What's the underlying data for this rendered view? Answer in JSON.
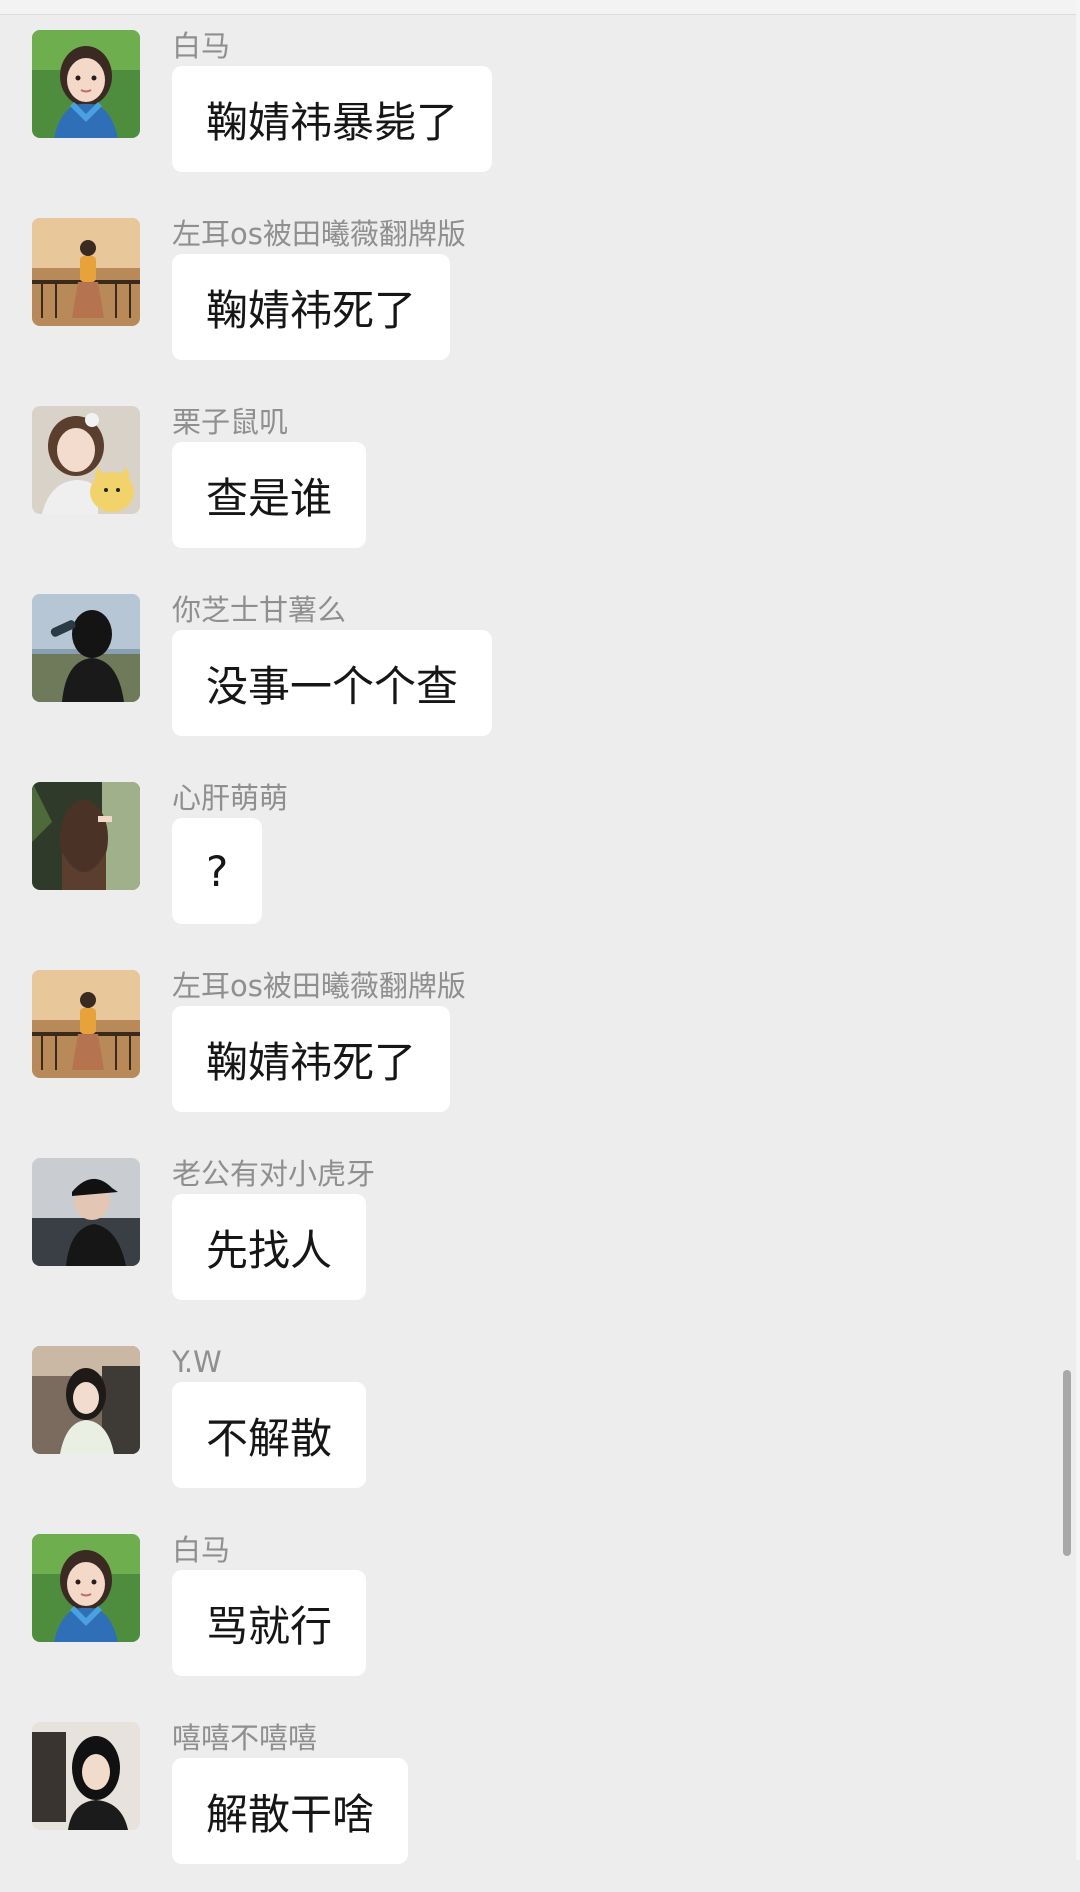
{
  "messages": [
    {
      "sender": "白马",
      "text": "鞠婧祎暴毙了",
      "avatar_icon": "girl-blue-scarf-avatar-icon"
    },
    {
      "sender": "左耳os被田曦薇翻牌版",
      "text": "鞠婧祎死了",
      "avatar_icon": "girl-balcony-avatar-icon"
    },
    {
      "sender": "栗子鼠叽",
      "text": "查是谁",
      "avatar_icon": "girl-cat-toy-avatar-icon"
    },
    {
      "sender": "你芝士甘薯么",
      "text": "没事一个个查",
      "avatar_icon": "girl-drinking-avatar-icon"
    },
    {
      "sender": "心肝萌萌",
      "text": "?",
      "avatar_icon": "girl-back-view-avatar-icon"
    },
    {
      "sender": "左耳os被田曦薇翻牌版",
      "text": "鞠婧祎死了",
      "avatar_icon": "girl-balcony-avatar-icon"
    },
    {
      "sender": "老公有对小虎牙",
      "text": "先找人",
      "avatar_icon": "man-cap-avatar-icon"
    },
    {
      "sender": "Y.W",
      "text": "不解散",
      "avatar_icon": "girl-street-avatar-icon"
    },
    {
      "sender": "白马",
      "text": "骂就行",
      "avatar_icon": "girl-blue-scarf-avatar-icon"
    },
    {
      "sender": "嘻嘻不嘻嘻",
      "text": "解散干啥",
      "avatar_icon": "girl-black-hair-avatar-icon"
    }
  ],
  "colors": {
    "background": "#ededed",
    "bubble": "#ffffff",
    "sender_text": "#8f8f8f",
    "message_text": "#161616"
  }
}
